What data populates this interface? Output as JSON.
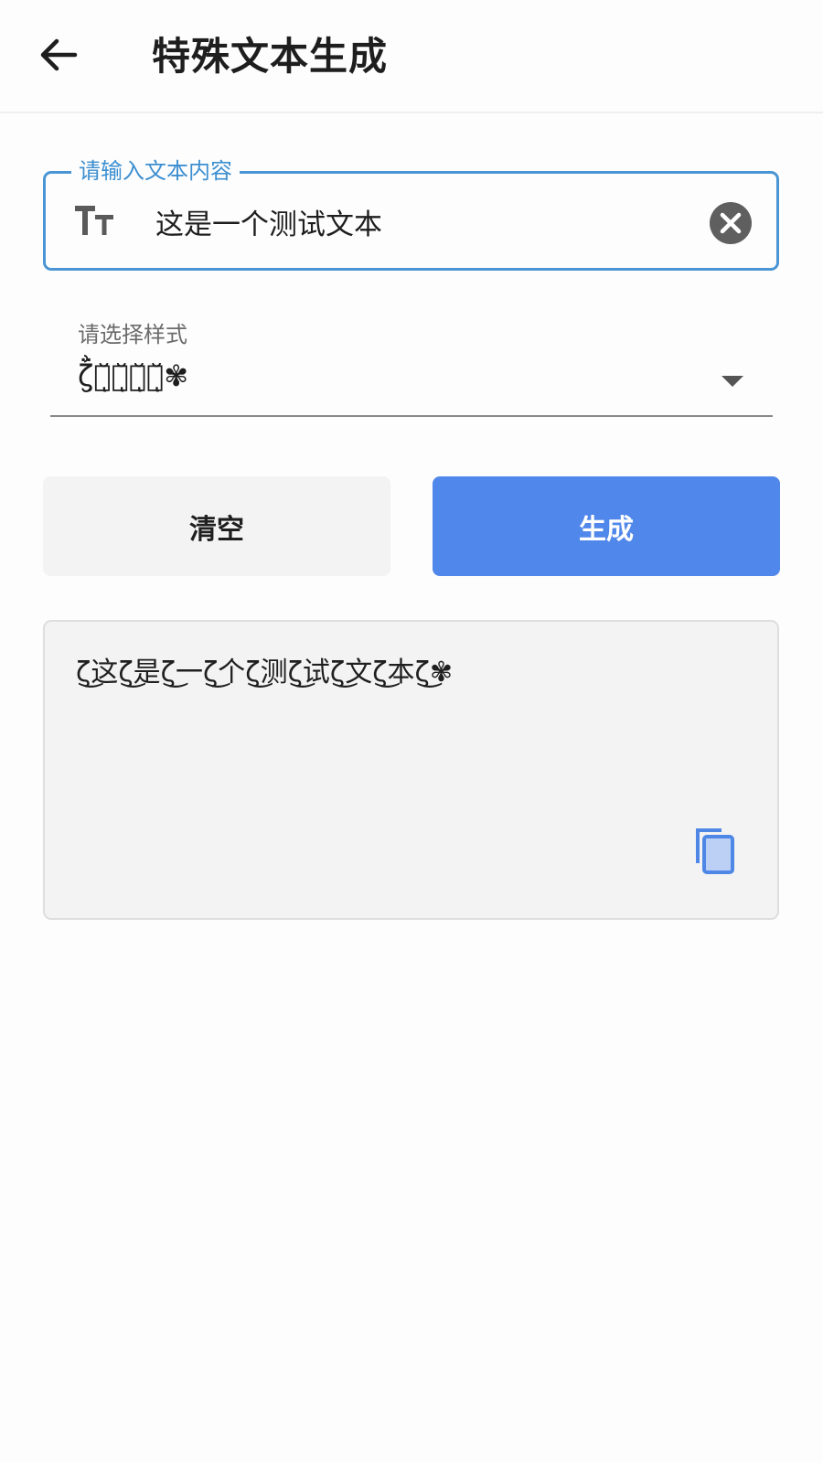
{
  "appbar": {
    "title": "特殊文本生成",
    "back_icon": "arrow-left-icon"
  },
  "input": {
    "label": "请输入文本内容",
    "value": "这是一个测试文本",
    "leading_icon": "text-size-icon",
    "trailing_icon": "clear-circle-icon"
  },
  "style_select": {
    "label": "请选择样式",
    "selected": "ζ̮͗̈测̆ͅ试̆ͅ测̆ͅ试̆ͅ✾",
    "arrow_icon": "dropdown-triangle-icon"
  },
  "buttons": {
    "clear": "清空",
    "generate": "生成"
  },
  "result": {
    "text": "ζ͜这ζ͜是ζ͜一ζ͜个ζ͜测ζ͜试ζ͜文ζ͜本ζ͜✾",
    "copy_icon": "copy-icon"
  },
  "colors": {
    "accent": "#4a95d3",
    "primary_button": "#5087ea",
    "secondary_button": "#f3f3f3",
    "copy_icon": "#4f87e6",
    "clear_icon": "#5f5f5f"
  }
}
